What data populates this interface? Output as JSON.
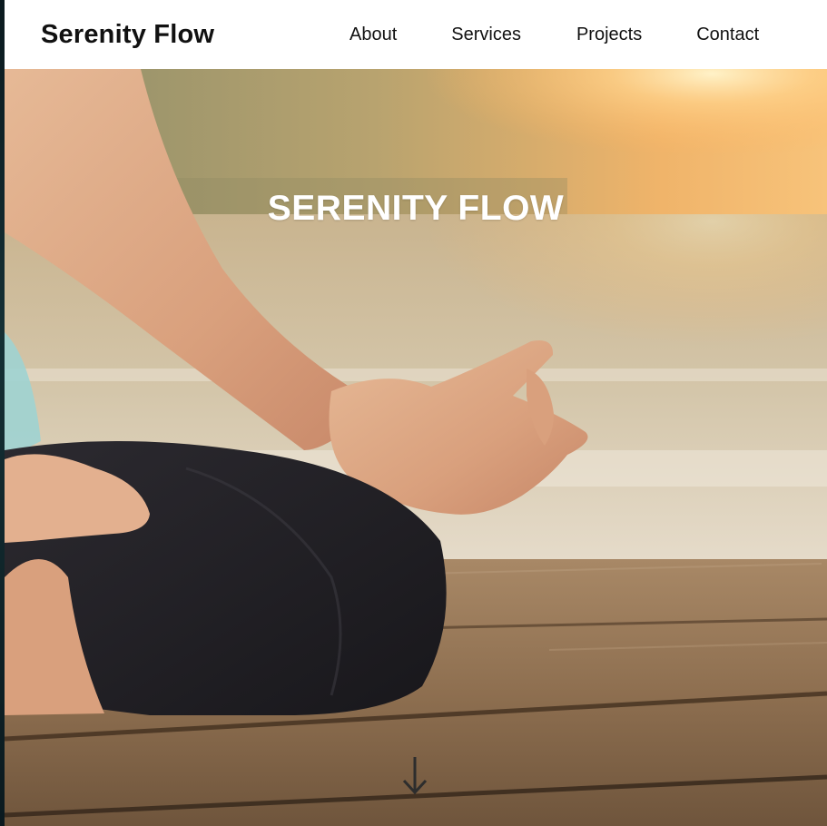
{
  "header": {
    "brand": "Serenity Flow",
    "nav": [
      {
        "label": "About"
      },
      {
        "label": "Services"
      },
      {
        "label": "Projects"
      },
      {
        "label": "Contact"
      }
    ]
  },
  "hero": {
    "title": "SERENITY FLOW",
    "scroll_icon": "arrow-down-icon"
  },
  "colors": {
    "header_bg": "#ffffff",
    "text": "#111111",
    "hero_title": "#ffffff"
  }
}
